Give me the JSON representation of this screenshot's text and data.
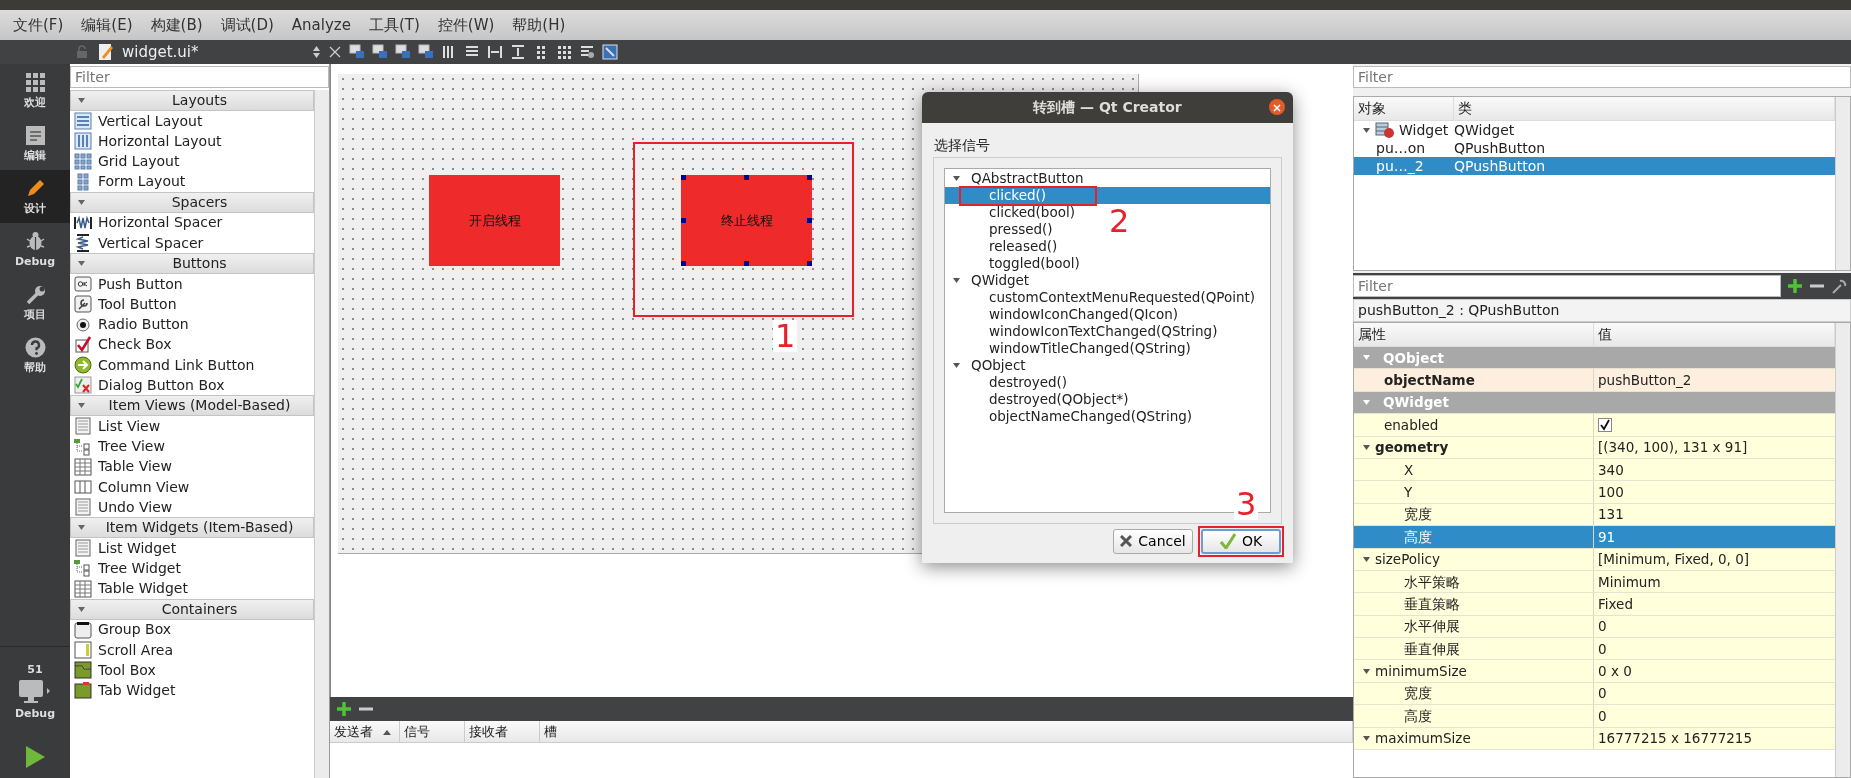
{
  "menu": [
    "文件(F)",
    "编辑(E)",
    "构建(B)",
    "调试(D)",
    "Analyze",
    "工具(T)",
    "控件(W)",
    "帮助(H)"
  ],
  "editor_toolbar": {
    "file": "widget.ui*"
  },
  "mode_bar": [
    {
      "label": "欢迎",
      "kind": "welcome",
      "selected": false
    },
    {
      "label": "编辑",
      "kind": "edit",
      "selected": false
    },
    {
      "label": "设计",
      "kind": "design",
      "selected": true
    },
    {
      "label": "Debug",
      "kind": "debug",
      "selected": false
    },
    {
      "label": "项目",
      "kind": "projects",
      "selected": false
    },
    {
      "label": "帮助",
      "kind": "help",
      "selected": false
    }
  ],
  "kit": {
    "number": "51",
    "label": "Debug"
  },
  "widget_box": {
    "filter_placeholder": "Filter",
    "groups": [
      {
        "title": "Layouts",
        "expanded": true,
        "items": [
          {
            "label": "Vertical Layout",
            "kind": "vlayout"
          },
          {
            "label": "Horizontal Layout",
            "kind": "hlayout"
          },
          {
            "label": "Grid Layout",
            "kind": "grid"
          },
          {
            "label": "Form Layout",
            "kind": "form"
          }
        ]
      },
      {
        "title": "Spacers",
        "expanded": true,
        "items": [
          {
            "label": "Horizontal Spacer",
            "kind": "hspacer"
          },
          {
            "label": "Vertical Spacer",
            "kind": "vspacer"
          }
        ]
      },
      {
        "title": "Buttons",
        "expanded": true,
        "items": [
          {
            "label": "Push Button",
            "kind": "push"
          },
          {
            "label": "Tool Button",
            "kind": "tool"
          },
          {
            "label": "Radio Button",
            "kind": "radio"
          },
          {
            "label": "Check Box",
            "kind": "check"
          },
          {
            "label": "Command Link Button",
            "kind": "command"
          },
          {
            "label": "Dialog Button Box",
            "kind": "dialogbox"
          }
        ]
      },
      {
        "title": "Item Views (Model-Based)",
        "expanded": true,
        "items": [
          {
            "label": "List View",
            "kind": "list"
          },
          {
            "label": "Tree View",
            "kind": "tree"
          },
          {
            "label": "Table View",
            "kind": "table"
          },
          {
            "label": "Column View",
            "kind": "column"
          },
          {
            "label": "Undo View",
            "kind": "list"
          }
        ]
      },
      {
        "title": "Item Widgets (Item-Based)",
        "expanded": true,
        "items": [
          {
            "label": "List Widget",
            "kind": "list"
          },
          {
            "label": "Tree Widget",
            "kind": "tree"
          },
          {
            "label": "Table Widget",
            "kind": "table"
          }
        ]
      },
      {
        "title": "Containers",
        "expanded": true,
        "items": [
          {
            "label": "Group Box",
            "kind": "groupbox"
          },
          {
            "label": "Scroll Area",
            "kind": "scroll"
          },
          {
            "label": "Tool Box",
            "kind": "toolbox"
          },
          {
            "label": "Tab Widget",
            "kind": "tab"
          }
        ]
      }
    ]
  },
  "form": {
    "buttons": [
      {
        "label": "开启线程",
        "selected": false
      },
      {
        "label": "终止线程",
        "selected": true
      }
    ]
  },
  "signal_slot_editor": {
    "columns": [
      "发送者",
      "信号",
      "接收者",
      "槽"
    ]
  },
  "dialog": {
    "title": "转到槽 — Qt Creator",
    "group_label": "选择信号",
    "tree": [
      {
        "label": "QAbstractButton",
        "expanded": true,
        "children": [
          {
            "label": "clicked()",
            "selected": true
          },
          {
            "label": "clicked(bool)",
            "selected": false
          },
          {
            "label": "pressed()",
            "selected": false
          },
          {
            "label": "released()",
            "selected": false
          },
          {
            "label": "toggled(bool)",
            "selected": false
          }
        ]
      },
      {
        "label": "QWidget",
        "expanded": true,
        "children": [
          {
            "label": "customContextMenuRequested(QPoint)",
            "selected": false
          },
          {
            "label": "windowIconChanged(QIcon)",
            "selected": false
          },
          {
            "label": "windowIconTextChanged(QString)",
            "selected": false
          },
          {
            "label": "windowTitleChanged(QString)",
            "selected": false
          }
        ]
      },
      {
        "label": "QObject",
        "expanded": true,
        "children": [
          {
            "label": "destroyed()",
            "selected": false
          },
          {
            "label": "destroyed(QObject*)",
            "selected": false
          },
          {
            "label": "objectNameChanged(QString)",
            "selected": false
          }
        ]
      }
    ],
    "buttons": [
      {
        "label": "Cancel",
        "kind": "cancel",
        "default": false
      },
      {
        "label": "OK",
        "kind": "ok",
        "default": true
      }
    ]
  },
  "annotations": [
    {
      "label": "1"
    },
    {
      "label": "2"
    },
    {
      "label": "3"
    }
  ],
  "object_inspector": {
    "filter_placeholder": "Filter",
    "columns": [
      "对象",
      "类"
    ],
    "rows": [
      {
        "object": "Widget",
        "class": "QWidget",
        "expanded": true,
        "selected": false,
        "children": [
          {
            "object": "pu…on",
            "class": "QPushButton",
            "selected": false
          },
          {
            "object": "pu…_2",
            "class": "QPushButton",
            "selected": true
          }
        ]
      }
    ]
  },
  "property_editor": {
    "filter_placeholder": "Filter",
    "title": "pushButton_2 : QPushButton",
    "columns": [
      "属性",
      "值"
    ],
    "rows": [
      {
        "name": "QObject",
        "expanded": true,
        "children": [
          {
            "name": "objectName",
            "kind": "text",
            "value": "pushButton_2",
            "modified": true,
            "selected": false
          }
        ]
      },
      {
        "name": "QWidget",
        "expanded": true,
        "children": [
          {
            "name": "enabled",
            "kind": "checkbox",
            "checked": true,
            "modified": false,
            "selected": false
          },
          {
            "name": "geometry",
            "kind": "text",
            "value": "[(340, 100), 131 x 91]",
            "modified": true,
            "selected": false,
            "expanded": true,
            "children": [
              {
                "name": "X",
                "kind": "text",
                "value": "340",
                "modified": false,
                "selected": false
              },
              {
                "name": "Y",
                "kind": "text",
                "value": "100",
                "modified": false,
                "selected": false
              },
              {
                "name": "宽度",
                "kind": "text",
                "value": "131",
                "modified": false,
                "selected": false
              },
              {
                "name": "高度",
                "kind": "text",
                "value": "91",
                "modified": false,
                "selected": true
              }
            ]
          },
          {
            "name": "sizePolicy",
            "kind": "text",
            "value": "[Minimum, Fixed, 0, 0]",
            "modified": false,
            "selected": false,
            "expanded": true,
            "children": [
              {
                "name": "水平策略",
                "kind": "text",
                "value": "Minimum",
                "modified": false,
                "selected": false
              },
              {
                "name": "垂直策略",
                "kind": "text",
                "value": "Fixed",
                "modified": false,
                "selected": false
              },
              {
                "name": "水平伸展",
                "kind": "text",
                "value": "0",
                "modified": false,
                "selected": false
              },
              {
                "name": "垂直伸展",
                "kind": "text",
                "value": "0",
                "modified": false,
                "selected": false
              }
            ]
          },
          {
            "name": "minimumSize",
            "kind": "text",
            "value": "0 x 0",
            "modified": false,
            "selected": false,
            "expanded": true,
            "children": [
              {
                "name": "宽度",
                "kind": "text",
                "value": "0",
                "modified": false,
                "selected": false
              },
              {
                "name": "高度",
                "kind": "text",
                "value": "0",
                "modified": false,
                "selected": false
              }
            ]
          },
          {
            "name": "maximumSize",
            "kind": "text",
            "value": "16777215 x 16777215",
            "modified": false,
            "selected": false,
            "expanded": true
          }
        ]
      }
    ]
  }
}
